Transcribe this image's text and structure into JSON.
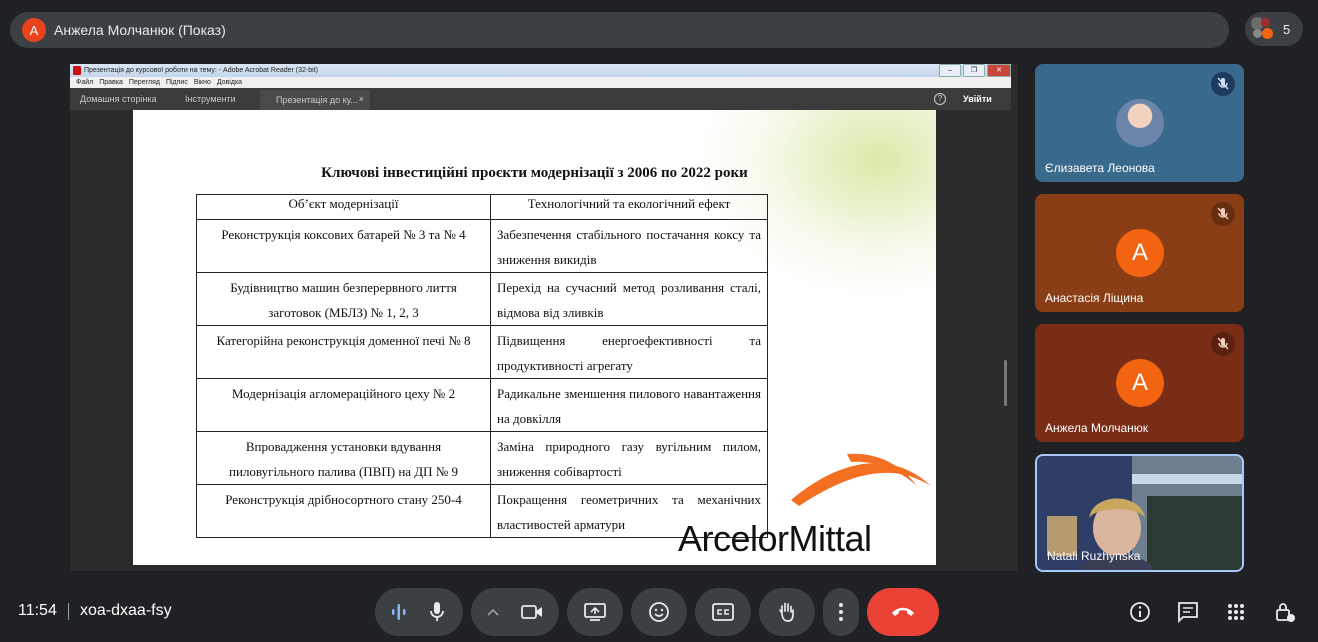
{
  "presenter": {
    "avatar_letter": "А",
    "title": "Анжела Молчанюк (Показ)"
  },
  "participants_count": "5",
  "shared_window": {
    "title": "Презентація до курсової роботи на тему: - Adobe Acrobat Reader (32-bit)",
    "menu": [
      "Файл",
      "Правка",
      "Перегляд",
      "Підпис",
      "Вікно",
      "Довідка"
    ],
    "tabs": {
      "home": "Домашня сторінка",
      "tools": "Інструменти",
      "doc": "Презентація до ку...",
      "close": "×"
    },
    "help": "?",
    "sign_in": "Увійти"
  },
  "slide": {
    "title": "Ключові інвестиційні проєкти модернізації з 2006 по 2022 роки",
    "table": {
      "headers": [
        "Об’єкт модернізації",
        "Технологічний та екологічний ефект"
      ],
      "rows": [
        {
          "object": "Реконструкція коксових батарей № 3 та № 4",
          "effect": "Забезпечення стабільного постачання коксу та зниження викидів"
        },
        {
          "object": "Будівництво машин безперервного лиття заготовок (МБЛЗ) № 1, 2, 3",
          "effect": "Перехід на сучасний метод розливання сталі, відмова від зливків"
        },
        {
          "object": "Категорійна реконструкція доменної печі № 8",
          "effect": "Підвищення енергоефективності та продуктивності агрегату"
        },
        {
          "object": "Модернізація агломераційного цеху № 2",
          "effect": "Радикальне зменшення пилового навантаження на довкілля"
        },
        {
          "object": "Впровадження установки вдування пиловугільного палива (ПВП) на ДП № 9",
          "effect": "Заміна природного газу вугільним пилом, зниження собівартості"
        },
        {
          "object": "Реконструкція дрібносортного стану 250-4",
          "effect": "Покращення геометричних та механічних властивостей арматури"
        }
      ]
    },
    "logo_text": "ArcelorMittal"
  },
  "tiles": [
    {
      "name": "Єлизавета Леонова",
      "type": "photo"
    },
    {
      "name": "Анастасія Ліщина",
      "letter": "А"
    },
    {
      "name": "Анжела Молчанюк",
      "letter": "А"
    },
    {
      "name": "Natali Ruzhynska",
      "type": "video"
    }
  ],
  "bottom": {
    "time": "11:54",
    "meeting_code": "xoa-dxaa-fsy"
  },
  "colors": {
    "background": "#202124",
    "accent": "#a8c7fa",
    "end_call": "#ea4335",
    "avatar": "#f2640f"
  },
  "icons": [
    "audio-levels-icon",
    "mic-icon",
    "chevron-up-icon",
    "camera-icon",
    "present-icon",
    "emoji-icon",
    "captions-icon",
    "raise-hand-icon",
    "more-vert-icon",
    "end-call-icon",
    "info-icon",
    "chat-icon",
    "activities-icon",
    "host-controls-icon",
    "mic-off-icon"
  ]
}
